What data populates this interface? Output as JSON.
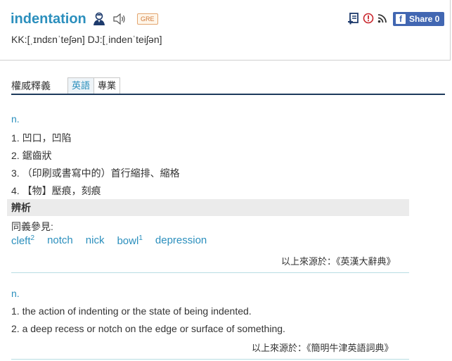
{
  "entry": {
    "word": "indentation",
    "badge": "GRE",
    "phonetic": "KK:[ˌɪndɛnˈteʃən] DJ:[ˌindenˈteiʃən]"
  },
  "toolbar": {
    "share_label": "Share 0",
    "fb_letter": "f"
  },
  "section": {
    "title": "權威釋義",
    "tabs": [
      "英語",
      "專業"
    ]
  },
  "block1": {
    "pos": "n.",
    "defs": [
      "1. 凹口，凹陷",
      "2. 鋸齒狀",
      "3. （印刷或書寫中的）首行縮排、縮格",
      "4. 【物】壓痕，刻痕"
    ],
    "analysis_label": "辨析",
    "synonym_label": "同義參見:",
    "synonyms": [
      {
        "text": "cleft",
        "sup": "2"
      },
      {
        "text": "notch",
        "sup": ""
      },
      {
        "text": "nick",
        "sup": ""
      },
      {
        "text": "bowl",
        "sup": "1"
      },
      {
        "text": "depression",
        "sup": ""
      }
    ],
    "source": "以上來源於：《英漢大辭典》"
  },
  "block2": {
    "pos": "n.",
    "defs": [
      "1. the action of indenting or the state of being indented.",
      "2. a deep recess or notch on the edge or surface of something."
    ],
    "source": "以上來源於：《簡明牛津英語詞典》"
  },
  "icons": {
    "person": "person-icon",
    "speaker": "speaker-icon",
    "note": "add-note-icon",
    "alert": "alert-icon",
    "rss": "rss-icon"
  }
}
